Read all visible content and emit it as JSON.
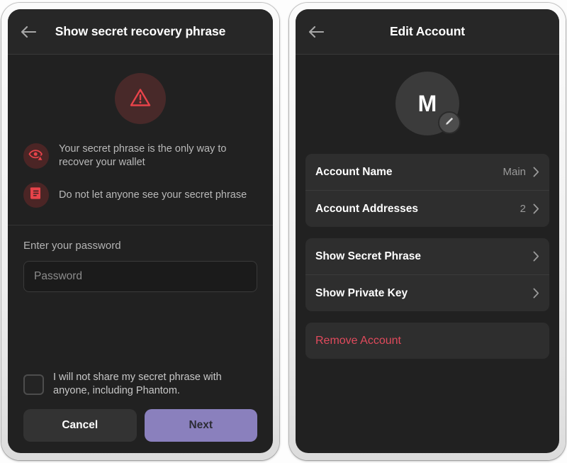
{
  "colors": {
    "screen_bg": "#212121",
    "header_bg": "#272727",
    "card_bg": "#2e2e2e",
    "accent_purple": "#8a80bd",
    "danger_red": "#e04a5c",
    "warn_red": "#e8434a",
    "warn_badge_bg": "#4b2525"
  },
  "left_panel": {
    "header": {
      "back_label": "Back",
      "title": "Show secret recovery phrase"
    },
    "hero_icon": "warning-triangle-icon",
    "warnings": [
      {
        "icon": "eye-warning-icon",
        "text": "Your secret phrase is the only way to recover your wallet"
      },
      {
        "icon": "document-warning-icon",
        "text": "Do not let anyone see your secret phrase"
      }
    ],
    "password_field": {
      "label": "Enter your password",
      "placeholder": "Password",
      "value": ""
    },
    "consent": {
      "checked": false,
      "text": "I will not share my secret phrase with anyone, including Phantom."
    },
    "buttons": {
      "cancel_label": "Cancel",
      "next_label": "Next"
    }
  },
  "right_panel": {
    "header": {
      "back_label": "Back",
      "title": "Edit Account"
    },
    "avatar": {
      "initial": "M",
      "edit_icon": "pencil-icon"
    },
    "info_rows": [
      {
        "label": "Account Name",
        "value": "Main",
        "chevron": "chevron-right-icon"
      },
      {
        "label": "Account Addresses",
        "value": "2",
        "chevron": "chevron-right-icon"
      }
    ],
    "secret_rows": [
      {
        "label": "Show Secret Phrase",
        "value": "",
        "chevron": "chevron-right-icon"
      },
      {
        "label": "Show Private Key",
        "value": "",
        "chevron": "chevron-right-icon"
      }
    ],
    "danger_rows": [
      {
        "label": "Remove Account"
      }
    ]
  }
}
